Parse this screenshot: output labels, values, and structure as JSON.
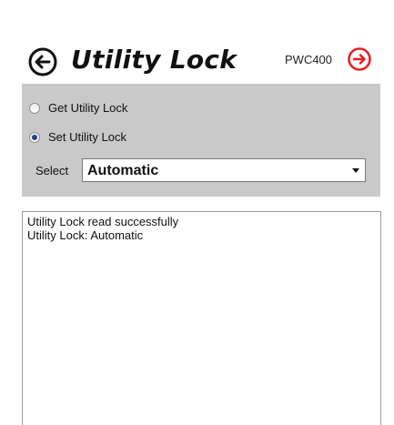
{
  "header": {
    "title": "Utility Lock",
    "device": "PWC400",
    "back_icon": "circle-arrow-left-icon",
    "next_icon": "circle-arrow-right-icon",
    "next_color": "#e8202a"
  },
  "options": {
    "get_label": "Get Utility Lock",
    "set_label": "Set Utility Lock",
    "selected_option": "Set Utility Lock",
    "select_label": "Select",
    "select_value": "Automatic"
  },
  "log": {
    "lines": [
      "Utility Lock read successfully",
      "Utility Lock: Automatic"
    ]
  }
}
